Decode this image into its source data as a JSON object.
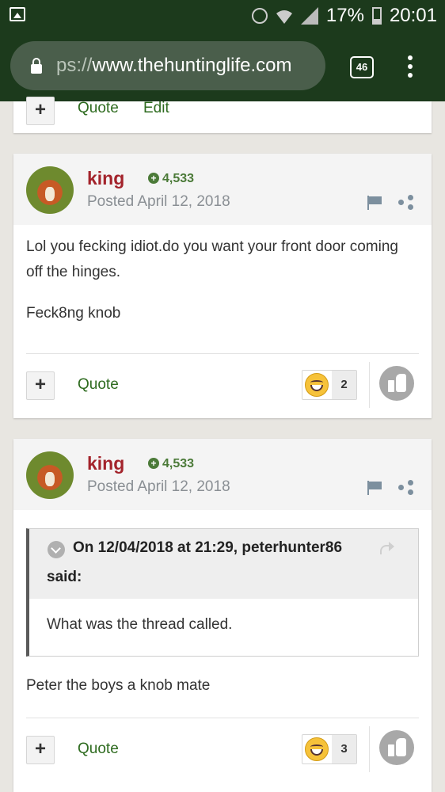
{
  "status_bar": {
    "battery": "17%",
    "time": "20:01",
    "icons": [
      "gallery-icon",
      "alarm-icon",
      "wifi-icon",
      "signal-icon",
      "battery-icon"
    ]
  },
  "browser": {
    "url_prefix": "ps://",
    "url_host": "www.thehuntinglife.com",
    "tab_count": "46"
  },
  "prev_post_footer": {
    "quote_label": "Quote",
    "edit_label": "Edit"
  },
  "posts": [
    {
      "author": "king",
      "reputation": "4,533",
      "posted": "Posted April 12, 2018",
      "paragraphs": [
        "Lol you fecking idiot.do you want your front door coming off the hinges.",
        "Feck8ng knob"
      ],
      "quote_label": "Quote",
      "reaction_count": "2"
    },
    {
      "author": "king",
      "reputation": "4,533",
      "posted": "Posted April 12, 2018",
      "quote": {
        "citation": "On 12/04/2018 at 21:29, peterhunter86",
        "said": "said:",
        "text": "What was the thread called."
      },
      "paragraphs": [
        "Peter the boys a knob mate"
      ],
      "quote_label": "Quote",
      "reaction_count": "3"
    }
  ],
  "colors": {
    "browser_chrome": "#1c3a1c",
    "author": "#a3232b",
    "reputation": "#4b7a38",
    "link": "#2e6b1f"
  }
}
